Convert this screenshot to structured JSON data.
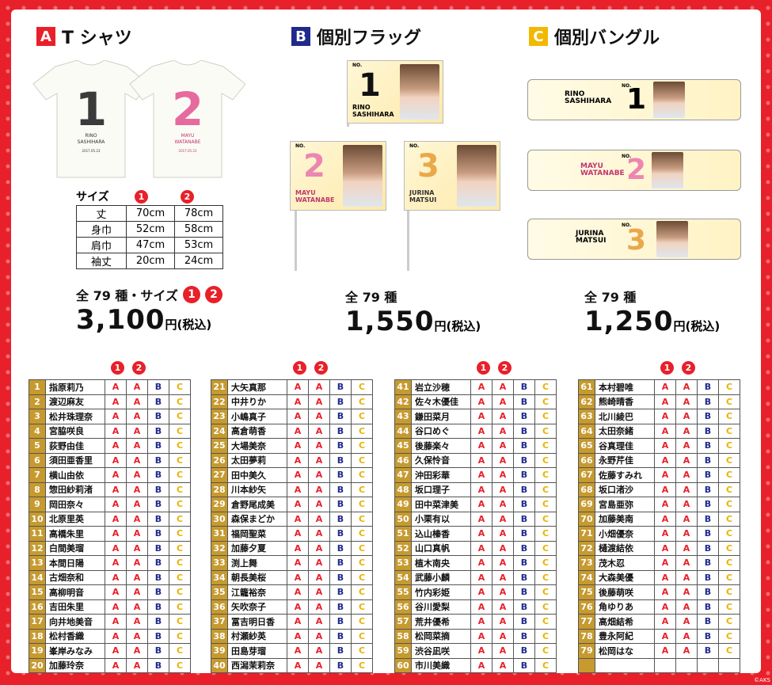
{
  "sections": {
    "a": {
      "letter": "A",
      "title": "T シャツ",
      "color": "#e8202a"
    },
    "b": {
      "letter": "B",
      "title": "個別フラッグ",
      "color": "#1f2a8c"
    },
    "c": {
      "letter": "C",
      "title": "個別バングル",
      "color": "#f2b800"
    }
  },
  "tshirts": [
    {
      "number": "1",
      "name_line1": "RINO",
      "name_line2": "SASHIHARA",
      "date": "2017.05.23"
    },
    {
      "number": "2",
      "name_line1": "MAYU",
      "name_line2": "WATANABE",
      "date": "2017.05.23"
    }
  ],
  "size_table": {
    "heading": "サイズ",
    "col1": "1",
    "col2": "2",
    "rows": [
      {
        "label": "丈",
        "s1": "70cm",
        "s2": "78cm"
      },
      {
        "label": "身巾",
        "s1": "52cm",
        "s2": "58cm"
      },
      {
        "label": "肩巾",
        "s1": "47cm",
        "s2": "53cm"
      },
      {
        "label": "袖丈",
        "s1": "20cm",
        "s2": "24cm"
      }
    ]
  },
  "flags": [
    {
      "no": "NO.",
      "number": "1",
      "name1": "RINO",
      "name2": "SASHIHARA"
    },
    {
      "no": "NO.",
      "number": "2",
      "name1": "MAYU",
      "name2": "WATANABE"
    },
    {
      "no": "NO.",
      "number": "3",
      "name1": "JURINA",
      "name2": "MATSUI"
    }
  ],
  "bangles": [
    {
      "no": "NO.",
      "number": "1",
      "name1": "RINO",
      "name2": "SASHIHARA"
    },
    {
      "no": "NO.",
      "number": "2",
      "name1": "MAYU",
      "name2": "WATANABE"
    },
    {
      "no": "NO.",
      "number": "3",
      "name1": "JURINA",
      "name2": "MATSUI"
    }
  ],
  "prices": {
    "a": {
      "kinds": "全 79 種・サイズ",
      "dot1": "1",
      "dot2": "2",
      "price": "3,100",
      "unit": "円(税込)"
    },
    "b": {
      "kinds": "全 79 種",
      "price": "1,550",
      "unit": "円(税込)"
    },
    "c": {
      "kinds": "全 79 種",
      "price": "1,250",
      "unit": "円(税込)"
    }
  },
  "table_header": {
    "dot1": "1",
    "dot2": "2"
  },
  "cells": {
    "a": "A",
    "b": "B",
    "c": "C"
  },
  "members": [
    [
      "1",
      "指原莉乃"
    ],
    [
      "2",
      "渡辺麻友"
    ],
    [
      "3",
      "松井珠理奈"
    ],
    [
      "4",
      "宮脇咲良"
    ],
    [
      "5",
      "荻野由佳"
    ],
    [
      "6",
      "須田亜香里"
    ],
    [
      "7",
      "横山由依"
    ],
    [
      "8",
      "惣田紗莉渚"
    ],
    [
      "9",
      "岡田奈々"
    ],
    [
      "10",
      "北原里英"
    ],
    [
      "11",
      "高橋朱里"
    ],
    [
      "12",
      "白間美瑠"
    ],
    [
      "13",
      "本間日陽"
    ],
    [
      "14",
      "古畑奈和"
    ],
    [
      "15",
      "高柳明音"
    ],
    [
      "16",
      "吉田朱里"
    ],
    [
      "17",
      "向井地美音"
    ],
    [
      "18",
      "松村香織"
    ],
    [
      "19",
      "峯岸みなみ"
    ],
    [
      "20",
      "加藤玲奈"
    ],
    [
      "21",
      "大矢真那"
    ],
    [
      "22",
      "中井りか"
    ],
    [
      "23",
      "小嶋真子"
    ],
    [
      "24",
      "高倉萌香"
    ],
    [
      "25",
      "大場美奈"
    ],
    [
      "26",
      "太田夢莉"
    ],
    [
      "27",
      "田中美久"
    ],
    [
      "28",
      "川本紗矢"
    ],
    [
      "29",
      "倉野尾成美"
    ],
    [
      "30",
      "森保まどか"
    ],
    [
      "31",
      "福岡聖菜"
    ],
    [
      "32",
      "加藤夕夏"
    ],
    [
      "33",
      "渕上舞"
    ],
    [
      "34",
      "朝長美桜"
    ],
    [
      "35",
      "江籠裕奈"
    ],
    [
      "36",
      "矢吹奈子"
    ],
    [
      "37",
      "冨吉明日香"
    ],
    [
      "38",
      "村瀬紗英"
    ],
    [
      "39",
      "田島芽瑠"
    ],
    [
      "40",
      "西潟茉莉奈"
    ],
    [
      "41",
      "岩立沙穂"
    ],
    [
      "42",
      "佐々木優佳"
    ],
    [
      "43",
      "鎌田菜月"
    ],
    [
      "44",
      "谷口めぐ"
    ],
    [
      "45",
      "後藤楽々"
    ],
    [
      "46",
      "久保怜音"
    ],
    [
      "47",
      "沖田彩華"
    ],
    [
      "48",
      "坂口理子"
    ],
    [
      "49",
      "田中菜津美"
    ],
    [
      "50",
      "小栗有以"
    ],
    [
      "51",
      "込山榛香"
    ],
    [
      "52",
      "山口真帆"
    ],
    [
      "53",
      "植木南央"
    ],
    [
      "54",
      "武藤小麟"
    ],
    [
      "55",
      "竹内彩姫"
    ],
    [
      "56",
      "谷川愛梨"
    ],
    [
      "57",
      "荒井優希"
    ],
    [
      "58",
      "松岡菜摘"
    ],
    [
      "59",
      "渋谷凪咲"
    ],
    [
      "60",
      "市川美織"
    ],
    [
      "61",
      "本村碧唯"
    ],
    [
      "62",
      "熊崎晴香"
    ],
    [
      "63",
      "北川綾巴"
    ],
    [
      "64",
      "太田奈緒"
    ],
    [
      "65",
      "谷真理佳"
    ],
    [
      "66",
      "永野芹佳"
    ],
    [
      "67",
      "佐藤すみれ"
    ],
    [
      "68",
      "坂口渚沙"
    ],
    [
      "69",
      "宮島亜弥"
    ],
    [
      "70",
      "加藤美南"
    ],
    [
      "71",
      "小畑優奈"
    ],
    [
      "72",
      "樋渡結依"
    ],
    [
      "73",
      "茂木忍"
    ],
    [
      "74",
      "大森美優"
    ],
    [
      "75",
      "後藤萌咲"
    ],
    [
      "76",
      "角ゆりあ"
    ],
    [
      "77",
      "高畑結希"
    ],
    [
      "78",
      "豊永阿紀"
    ],
    [
      "79",
      "松岡はな"
    ]
  ],
  "copyright": "©AKS"
}
